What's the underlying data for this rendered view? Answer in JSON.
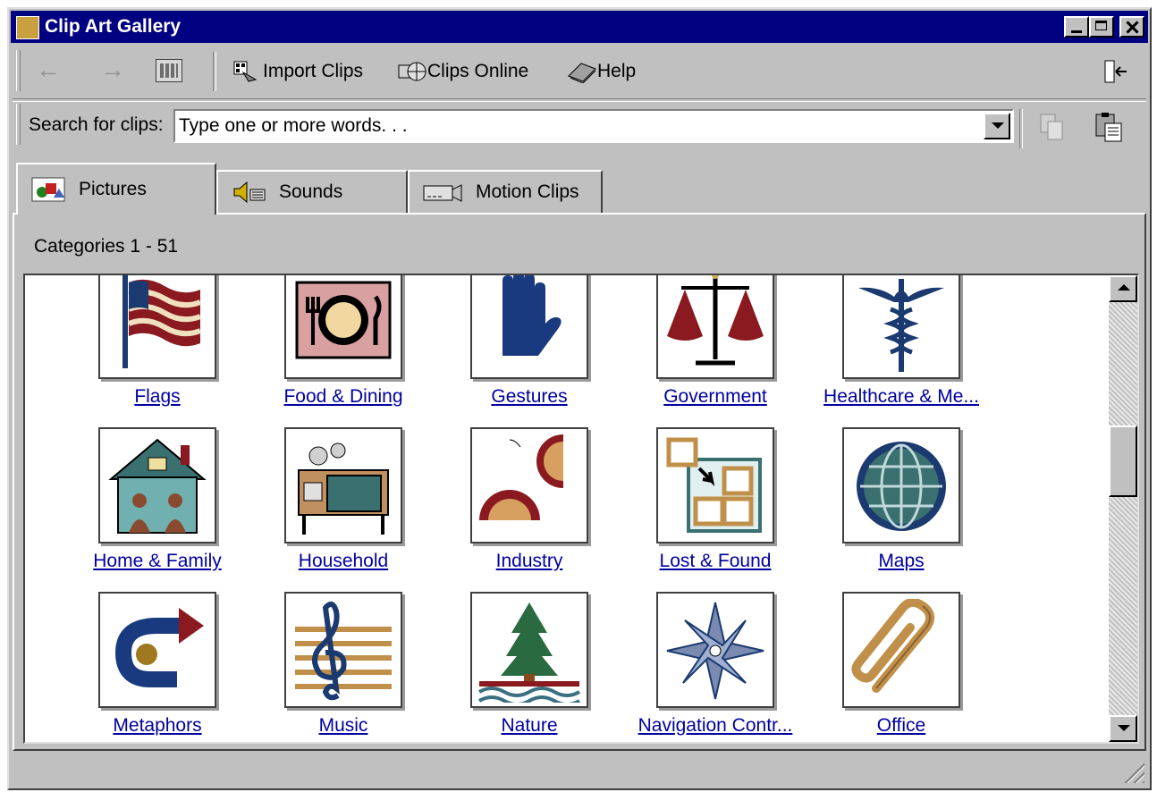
{
  "window": {
    "title": "Clip Art Gallery"
  },
  "toolbar": {
    "back_glyph": "←",
    "forward_glyph": "→",
    "import_label": "Import Clips",
    "online_label": "Clips Online",
    "help_label": "Help"
  },
  "search": {
    "label": "Search for clips:",
    "value": "Type one or more words. . ."
  },
  "tabs": [
    {
      "label": "Pictures",
      "icon": "pictures-icon",
      "active": true
    },
    {
      "label": "Sounds",
      "icon": "speaker-icon",
      "active": false
    },
    {
      "label": "Motion Clips",
      "icon": "camera-icon",
      "active": false
    }
  ],
  "panel": {
    "categories_label": "Categories 1 - 51"
  },
  "categories": [
    {
      "label": "Flags",
      "icon": "flag-icon"
    },
    {
      "label": "Food & Dining",
      "icon": "plate-icon"
    },
    {
      "label": "Gestures",
      "icon": "hand-icon"
    },
    {
      "label": "Government",
      "icon": "scales-icon"
    },
    {
      "label": "Healthcare & Me...",
      "icon": "caduceus-icon"
    },
    {
      "label": "Home & Family",
      "icon": "house-icon"
    },
    {
      "label": "Household",
      "icon": "stove-icon"
    },
    {
      "label": "Industry",
      "icon": "gears-icon"
    },
    {
      "label": "Lost & Found",
      "icon": "boxes-icon"
    },
    {
      "label": "Maps",
      "icon": "globe-icon"
    },
    {
      "label": "Metaphors",
      "icon": "arrow-curve-icon"
    },
    {
      "label": "Music",
      "icon": "treble-clef-icon"
    },
    {
      "label": "Nature",
      "icon": "tree-icon"
    },
    {
      "label": "Navigation Contr...",
      "icon": "compass-star-icon"
    },
    {
      "label": "Office",
      "icon": "paperclip-icon"
    }
  ],
  "colors": {
    "titlebar": "#000080",
    "chrome": "#c0c0c0",
    "link": "#0000a0"
  }
}
